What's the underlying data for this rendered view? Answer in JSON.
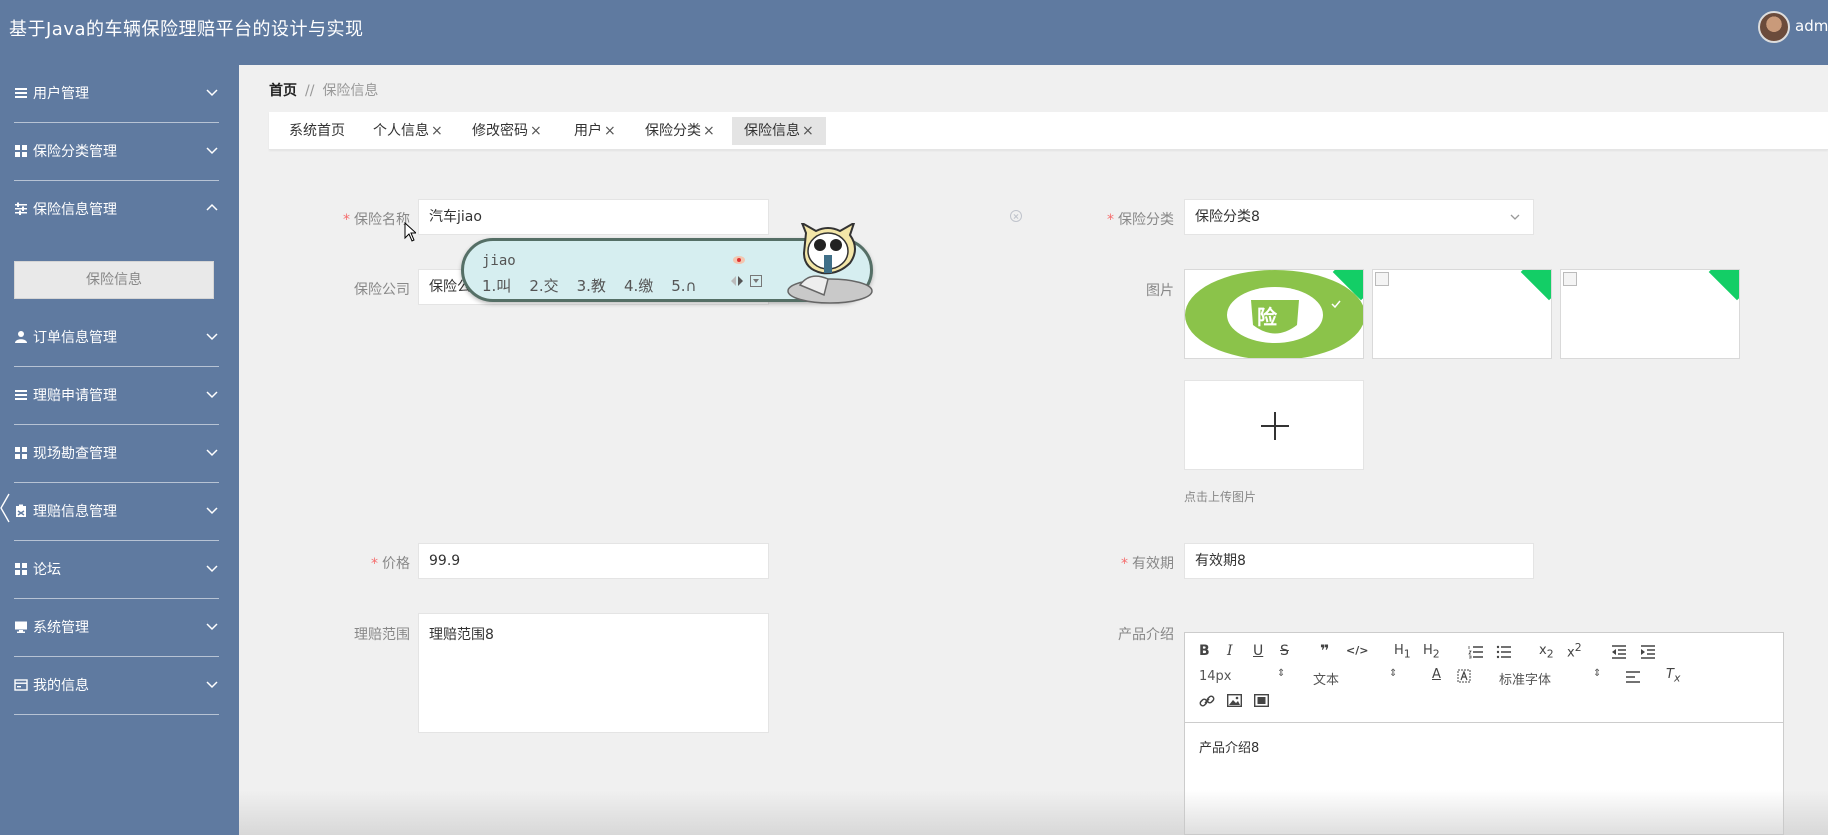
{
  "header": {
    "title": "基于Java的车辆保险理赔平台的设计与实现",
    "user": "adm"
  },
  "sidebar": {
    "items": [
      {
        "label": "用户管理",
        "icon": "list-icon",
        "expanded": false
      },
      {
        "label": "保险分类管理",
        "icon": "grid-icon",
        "expanded": false
      },
      {
        "label": "保险信息管理",
        "icon": "sliders-icon",
        "expanded": true,
        "sub": "保险信息"
      },
      {
        "label": "订单信息管理",
        "icon": "user-icon",
        "expanded": false
      },
      {
        "label": "理赔申请管理",
        "icon": "list-icon",
        "expanded": false
      },
      {
        "label": "现场勘查管理",
        "icon": "grid-icon",
        "expanded": false
      },
      {
        "label": "理赔信息管理",
        "icon": "clipboard-icon",
        "expanded": false
      },
      {
        "label": "论坛",
        "icon": "grid-icon",
        "expanded": false
      },
      {
        "label": "系统管理",
        "icon": "monitor-icon",
        "expanded": false
      },
      {
        "label": "我的信息",
        "icon": "card-icon",
        "expanded": false
      }
    ]
  },
  "breadcrumb": {
    "home": "首页",
    "separator": "//",
    "current": "保险信息"
  },
  "tabs": [
    {
      "label": "系统首页",
      "closable": false
    },
    {
      "label": "个人信息",
      "closable": true
    },
    {
      "label": "修改密码",
      "closable": true
    },
    {
      "label": "用户",
      "closable": true
    },
    {
      "label": "保险分类",
      "closable": true
    },
    {
      "label": "保险信息",
      "closable": true,
      "active": true
    }
  ],
  "tab_close_glyph": "×",
  "form": {
    "name": {
      "label": "保险名称",
      "value": "汽车jiao",
      "required": true
    },
    "company": {
      "label": "保险公司",
      "value": "保险公"
    },
    "category": {
      "label": "保险分类",
      "value": "保险分类8",
      "required": true
    },
    "image": {
      "label": "图片",
      "upload_hint": "点击上传图片",
      "badge_text": "险"
    },
    "price": {
      "label": "价格",
      "value": "99.9",
      "required": true
    },
    "validity": {
      "label": "有效期",
      "value": "有效期8",
      "required": true
    },
    "scope": {
      "label": "理赔范围",
      "value": "理赔范围8"
    },
    "intro": {
      "label": "产品介绍",
      "value": "产品介绍8"
    }
  },
  "editor": {
    "font_size": "14px",
    "header_select": "文本",
    "font_family": "标准字体",
    "buttons": [
      "B",
      "I",
      "U",
      "S",
      "❞",
      "</>",
      "H1",
      "H2",
      "ol",
      "ul",
      "x2",
      "x2",
      "outdent",
      "indent",
      "A",
      "bg",
      "align",
      "Tx",
      "link",
      "image",
      "video"
    ]
  },
  "ime": {
    "pinyin": "jiao",
    "candidates": [
      "1.叫",
      "2.交",
      "3.教",
      "4.缴",
      "5.∩"
    ]
  },
  "colors": {
    "primary": "#5f7aa0",
    "required": "#f56c6c",
    "upload_ok": "#13ce66",
    "badge_green": "#8bc34a"
  }
}
